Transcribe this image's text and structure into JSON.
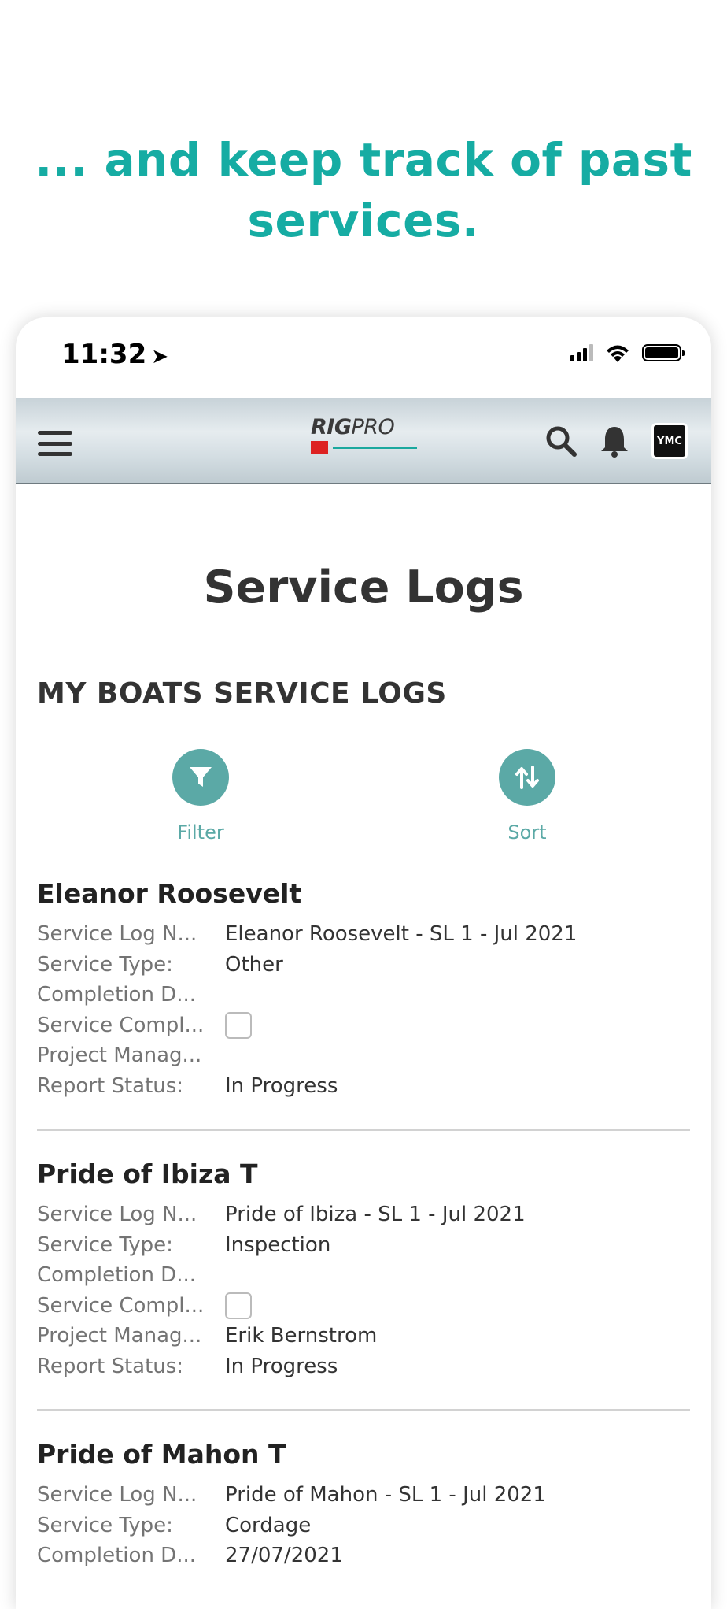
{
  "headline": {
    "line1": "... and keep track of past",
    "line2": "services."
  },
  "status_bar": {
    "time": "11:32",
    "location_glyph": "➤"
  },
  "header": {
    "logo_primary": "RIG",
    "logo_secondary": "PRO",
    "avatar_text": "YMC",
    "icons": [
      "menu-icon",
      "search-icon",
      "bell-icon"
    ]
  },
  "page": {
    "title": "Service Logs",
    "section_title": "MY BOATS SERVICE LOGS",
    "filter_label": "Filter",
    "sort_label": "Sort"
  },
  "labels": {
    "log_name": "Service Log N...",
    "service_type": "Service Type:",
    "completion_date": "Completion D...",
    "service_complete": "Service Compl...",
    "project_manager": "Project Manag...",
    "report_status": "Report Status:"
  },
  "records": [
    {
      "boat": "Eleanor Roosevelt",
      "log_name": "Eleanor Roosevelt - SL 1 - Jul 2021",
      "service_type": "Other",
      "completion_date": "",
      "project_manager": "",
      "report_status": "In Progress"
    },
    {
      "boat": "Pride of Ibiza  T",
      "log_name": "Pride of Ibiza - SL 1 - Jul 2021",
      "service_type": "Inspection",
      "completion_date": "",
      "project_manager": "Erik Bernstrom",
      "report_status": "In Progress"
    },
    {
      "boat": "Pride of Mahon  T",
      "log_name": "Pride of Mahon - SL 1 - Jul 2021",
      "service_type": "Cordage",
      "completion_date": "27/07/2021"
    }
  ],
  "colors": {
    "accent": "#16aca3",
    "action": "#5ba9a6"
  }
}
